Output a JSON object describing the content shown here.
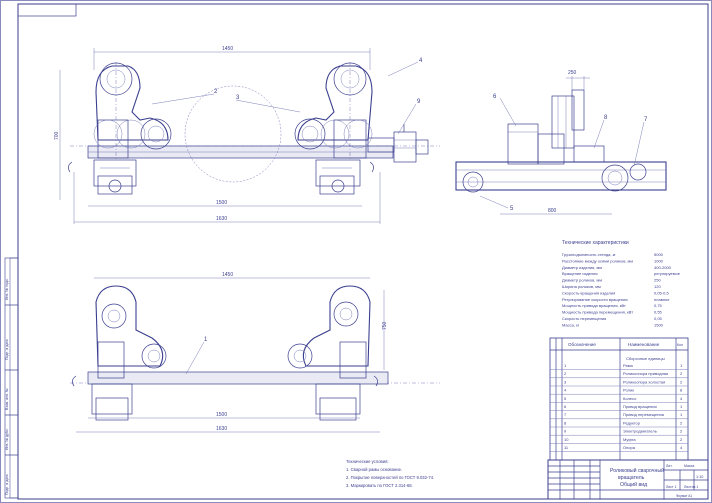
{
  "dimensions": {
    "top_width": "1450",
    "top_height": "700",
    "top_base1": "1500",
    "top_base2": "1630",
    "right_top": "250",
    "right_bottom": "800",
    "plan_width": "1450",
    "plan_height": "750",
    "plan_base1": "1500",
    "plan_base2": "1630"
  },
  "callouts": {
    "c1": "1",
    "c2": "2",
    "c3": "3",
    "c4": "4",
    "c5": "5",
    "c6": "6",
    "c7": "7",
    "c8": "8",
    "c9": "9"
  },
  "specs": {
    "title": "Технические характеристики",
    "rows": [
      [
        "Грузоподъемность стенда, кг",
        "5000"
      ],
      [
        "Расстояние между осями роликов, мм",
        "1000"
      ],
      [
        "Диаметр изделия, мм",
        "400-2000"
      ],
      [
        "Вращение изделия",
        "регулируемое"
      ],
      [
        "Диаметр роликов, мм",
        "250"
      ],
      [
        "Ширина роликов, мм",
        "120"
      ],
      [
        "Скорость вращения изделия",
        "0,05-0,5"
      ],
      [
        "Регулирование скорости вращения",
        "плавное"
      ],
      [
        "Мощность привода вращения, кВт",
        "0,75"
      ],
      [
        "Мощность привода перемещения, кВт",
        "0,55"
      ],
      [
        "Скорость перемещения",
        "0,05"
      ],
      [
        "Масса, кг",
        "1500"
      ]
    ]
  },
  "notes": {
    "n1": "Технические условия:",
    "n2": "1. Сварной рамы основание.",
    "n3": "2. Покрытие поверхностей по ГОСТ 9.032-74.",
    "n4": "3. Маркировать по ГОСТ 2.314-68."
  },
  "table": {
    "h_designation": "Обозначение",
    "h_name": "Наименование",
    "h_qty": "Кол",
    "section": "Сборочные единицы",
    "rows": [
      [
        "1",
        "Рама",
        "1"
      ],
      [
        "2",
        "Роликоопора приводная",
        "2"
      ],
      [
        "3",
        "Роликоопора холостая",
        "2"
      ],
      [
        "4",
        "Ролик",
        "8"
      ],
      [
        "5",
        "Колесо",
        "4"
      ],
      [
        "6",
        "Привод вращения",
        "1"
      ],
      [
        "7",
        "Привод перемещения",
        "1"
      ],
      [
        "8",
        "Редуктор",
        "2"
      ],
      [
        "9",
        "Электродвигатель",
        "2"
      ],
      [
        "10",
        "Муфта",
        "2"
      ],
      [
        "11",
        "Опора",
        "4"
      ]
    ]
  },
  "title_block": {
    "name1": "Роликовый сварочный",
    "name2": "вращатель",
    "name3": "Общий вид",
    "lit": "Лит.",
    "mass": "Масса",
    "scale": "1:10",
    "sheet": "Лист 1",
    "sheets": "Листов 1",
    "format": "Формат A1"
  },
  "side_stamp": {
    "s1": "Инв. № подл.",
    "s2": "Подп. и дата",
    "s3": "Взам. инв. №",
    "s4": "Инв. № дубл.",
    "s5": "Подп. и дата"
  }
}
